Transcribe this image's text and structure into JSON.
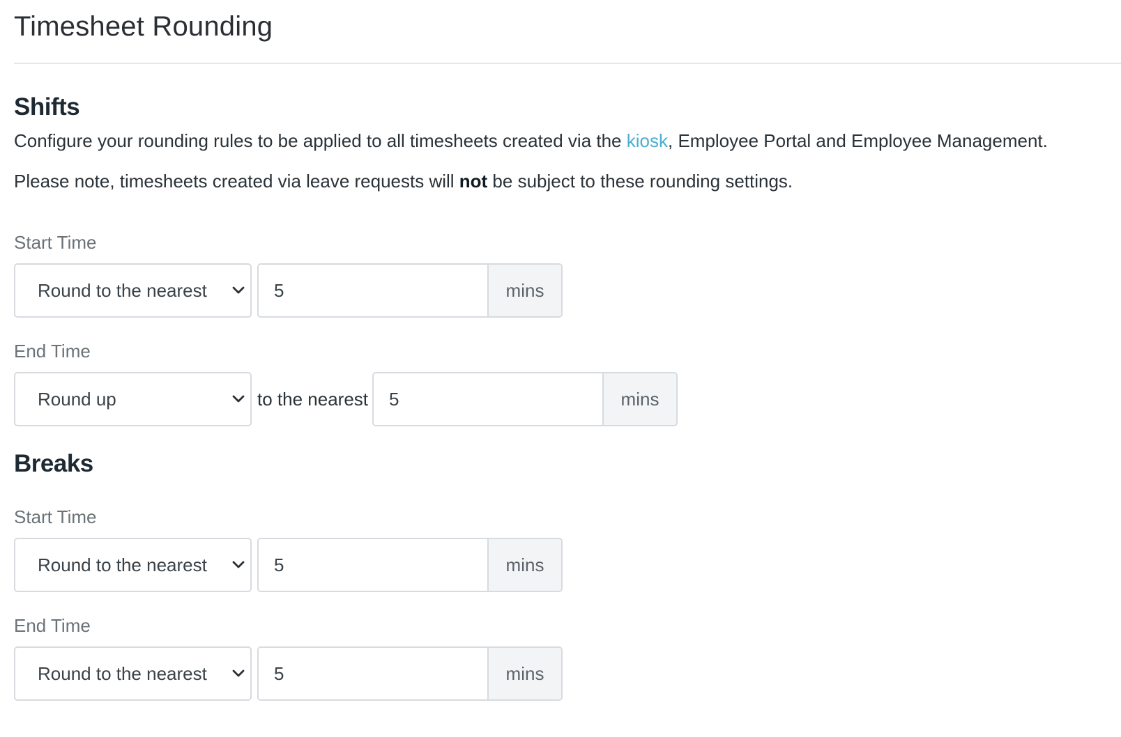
{
  "page": {
    "title": "Timesheet Rounding"
  },
  "shifts": {
    "heading": "Shifts",
    "description_before_link": "Configure your rounding rules to be applied to all timesheets created via the ",
    "description_link": "kiosk",
    "description_after_link": ", Employee Portal and Employee Management.",
    "note_before": "Please note, timesheets created via leave requests will ",
    "note_bold": "not",
    "note_after": " be subject to these rounding settings.",
    "start_time": {
      "label": "Start Time",
      "mode": "Round to the nearest",
      "value": "5",
      "unit": "mins"
    },
    "end_time": {
      "label": "End Time",
      "mode": "Round up",
      "connector": "to the nearest",
      "value": "5",
      "unit": "mins"
    }
  },
  "breaks": {
    "heading": "Breaks",
    "start_time": {
      "label": "Start Time",
      "mode": "Round to the nearest",
      "value": "5",
      "unit": "mins"
    },
    "end_time": {
      "label": "End Time",
      "mode": "Round to the nearest",
      "value": "5",
      "unit": "mins"
    }
  },
  "icons": {
    "select_chevron": "chevron-down-icon"
  },
  "colors": {
    "link": "#4aaed0",
    "border": "#d7dbdf",
    "addon_bg": "#f3f4f6",
    "label": "#6a7277"
  }
}
